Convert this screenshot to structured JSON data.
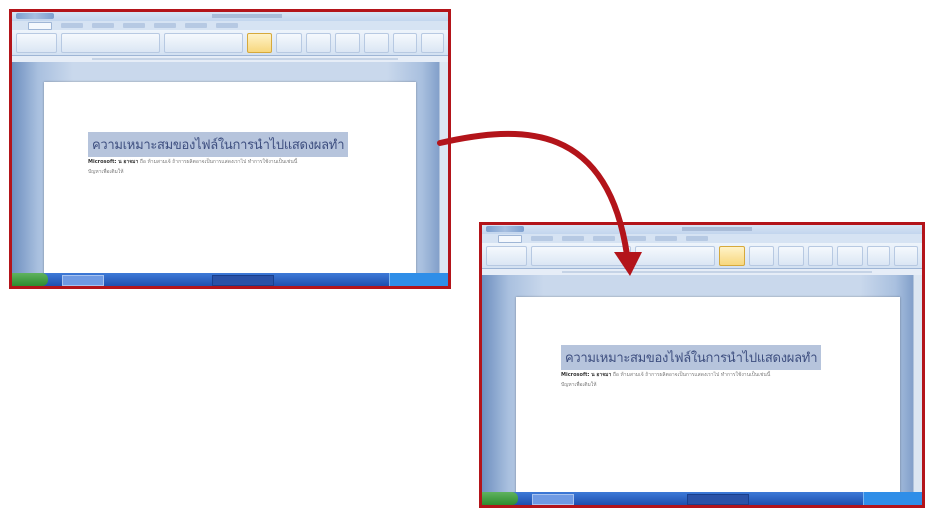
{
  "screenshots": [
    {
      "heading": "ความเหมาะสมของไฟล์ในการนำไปแสดงผลทำ",
      "body_line_1_bold": "Microsoft: น อาจมา",
      "body_line_1_rest": " ถือ ห้ามสามเจ้ ถ้าการผลิตอาจเป็นการแสดงเราไป ทำการใช้งานเป็นเช่นนี้",
      "body_line_2": "ปัญหาเพื่อเติมให้"
    },
    {
      "heading": "ความเหมาะสมของไฟล์ในการนำไปแสดงผลทำ",
      "body_line_1_bold": "Microsoft: น อาจมา",
      "body_line_1_rest": " ถือ ห้ามสามเจ้ ถ้าการผลิตอาจเป็นการแสดงเราไป ทำการใช้งานเป็นเช่นนี้",
      "body_line_2": "ปัญหาเพื่อเติมให้"
    }
  ],
  "colors": {
    "frame_border": "#b3141a",
    "arrow": "#b3141a",
    "heading_highlight": "#b6c4dc",
    "heading_text": "#3e4f80"
  },
  "icons": {
    "arrow": "curved-arrow-right-down"
  }
}
